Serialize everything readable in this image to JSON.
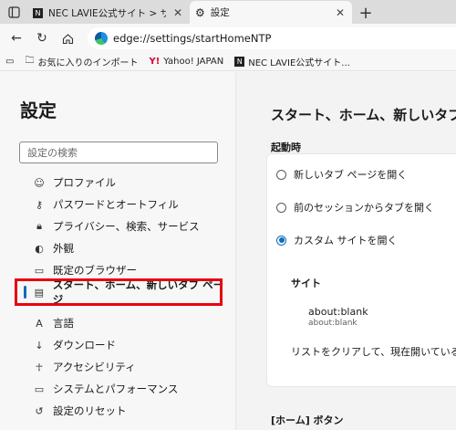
{
  "tabs": [
    {
      "title": "NEC LAVIE公式サイト > サービス＆サ",
      "active": false
    },
    {
      "title": "設定",
      "active": true
    }
  ],
  "address_bar": {
    "url": "edge://settings/startHomeNTP"
  },
  "favorites": [
    {
      "label": "お気に入りのインポート",
      "icon": "folder-import-icon"
    },
    {
      "label": "Yahoo! JAPAN",
      "icon": "yahoo-icon"
    },
    {
      "label": "NEC LAVIE公式サイト...",
      "icon": "nec-icon"
    }
  ],
  "sidebar": {
    "title": "設定",
    "search_placeholder": "設定の検索",
    "items": [
      {
        "label": "プロファイル",
        "icon": "profile-icon"
      },
      {
        "label": "パスワードとオートフィル",
        "icon": "key-icon"
      },
      {
        "label": "プライバシー、検索、サービス",
        "icon": "lock-icon"
      },
      {
        "label": "外観",
        "icon": "palette-icon"
      },
      {
        "label": "既定のブラウザー",
        "icon": "browser-icon"
      },
      {
        "label": "スタート、ホーム、新しいタブ ページ",
        "icon": "start-page-icon",
        "selected": true
      },
      {
        "label": "言語",
        "icon": "language-icon"
      },
      {
        "label": "ダウンロード",
        "icon": "download-icon"
      },
      {
        "label": "アクセシビリティ",
        "icon": "accessibility-icon"
      },
      {
        "label": "システムとパフォーマンス",
        "icon": "laptop-icon"
      },
      {
        "label": "設定のリセット",
        "icon": "reset-icon"
      }
    ]
  },
  "main": {
    "title": "スタート、ホーム、新しいタブ",
    "startup_label": "起動時",
    "options": [
      {
        "label": "新しいタブ ページを開く",
        "checked": false
      },
      {
        "label": "前のセッションからタブを開く",
        "checked": false
      },
      {
        "label": "カスタム サイトを開く",
        "checked": true
      }
    ],
    "sites_label": "サイト",
    "site_entry": {
      "title": "about:blank",
      "url": "about:blank"
    },
    "clear_text": "リストをクリアして、現在開いている",
    "home_button_label": "[ホーム] ボタン"
  },
  "colors": {
    "accent": "#0f6cbd",
    "highlight": "#e8000d"
  }
}
